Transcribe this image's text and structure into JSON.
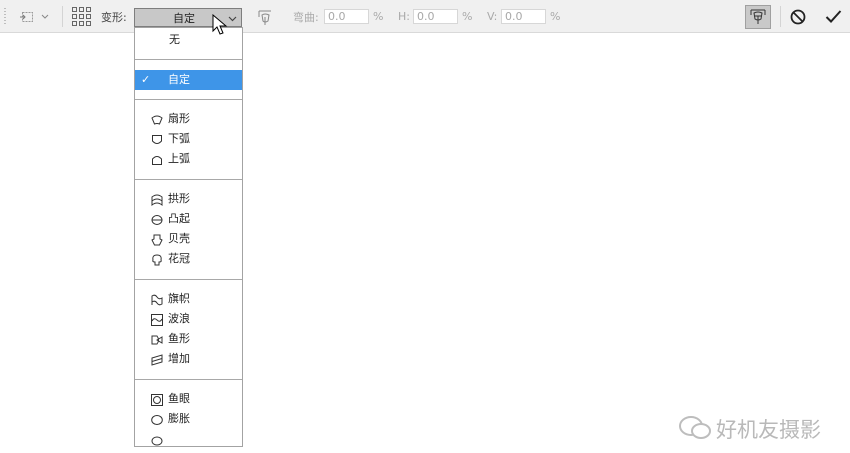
{
  "toolbar": {
    "transform_label": "变形:",
    "warp_style_value": "自定",
    "bend_label": "弯曲:",
    "bend_value": "0.0",
    "h_label": "H:",
    "h_value": "0.0",
    "v_label": "V:",
    "v_value": "0.0",
    "percent": "%",
    "icons": {
      "reference_point": "reference-point-icon",
      "grid": "grid-icon",
      "warp_orientation": "warp-orientation-icon",
      "switch_warp": "warp-mode-icon",
      "cancel": "cancel-icon",
      "commit": "checkmark-icon"
    }
  },
  "dropdown": {
    "none_label": "无",
    "selected_label": "自定",
    "groups": [
      [
        {
          "label": "扇形",
          "icon": "arc-icon"
        },
        {
          "label": "下弧",
          "icon": "arc-lower-icon"
        },
        {
          "label": "上弧",
          "icon": "arc-upper-icon"
        }
      ],
      [
        {
          "label": "拱形",
          "icon": "arch-icon"
        },
        {
          "label": "凸起",
          "icon": "bulge-icon"
        },
        {
          "label": "贝壳",
          "icon": "shell-icon"
        },
        {
          "label": "花冠",
          "icon": "flower-icon"
        }
      ],
      [
        {
          "label": "旗帜",
          "icon": "flag-icon"
        },
        {
          "label": "波浪",
          "icon": "wave-icon"
        },
        {
          "label": "鱼形",
          "icon": "fish-icon"
        },
        {
          "label": "增加",
          "icon": "rise-icon"
        }
      ],
      [
        {
          "label": "鱼眼",
          "icon": "fisheye-icon"
        },
        {
          "label": "膨胀",
          "icon": "inflate-icon"
        }
      ]
    ]
  },
  "watermark": {
    "text": "好机友摄影",
    "icon": "wechat-icon"
  },
  "colors": {
    "selection": "#3e95e8",
    "toolbar_bg": "#f0f0f0"
  }
}
